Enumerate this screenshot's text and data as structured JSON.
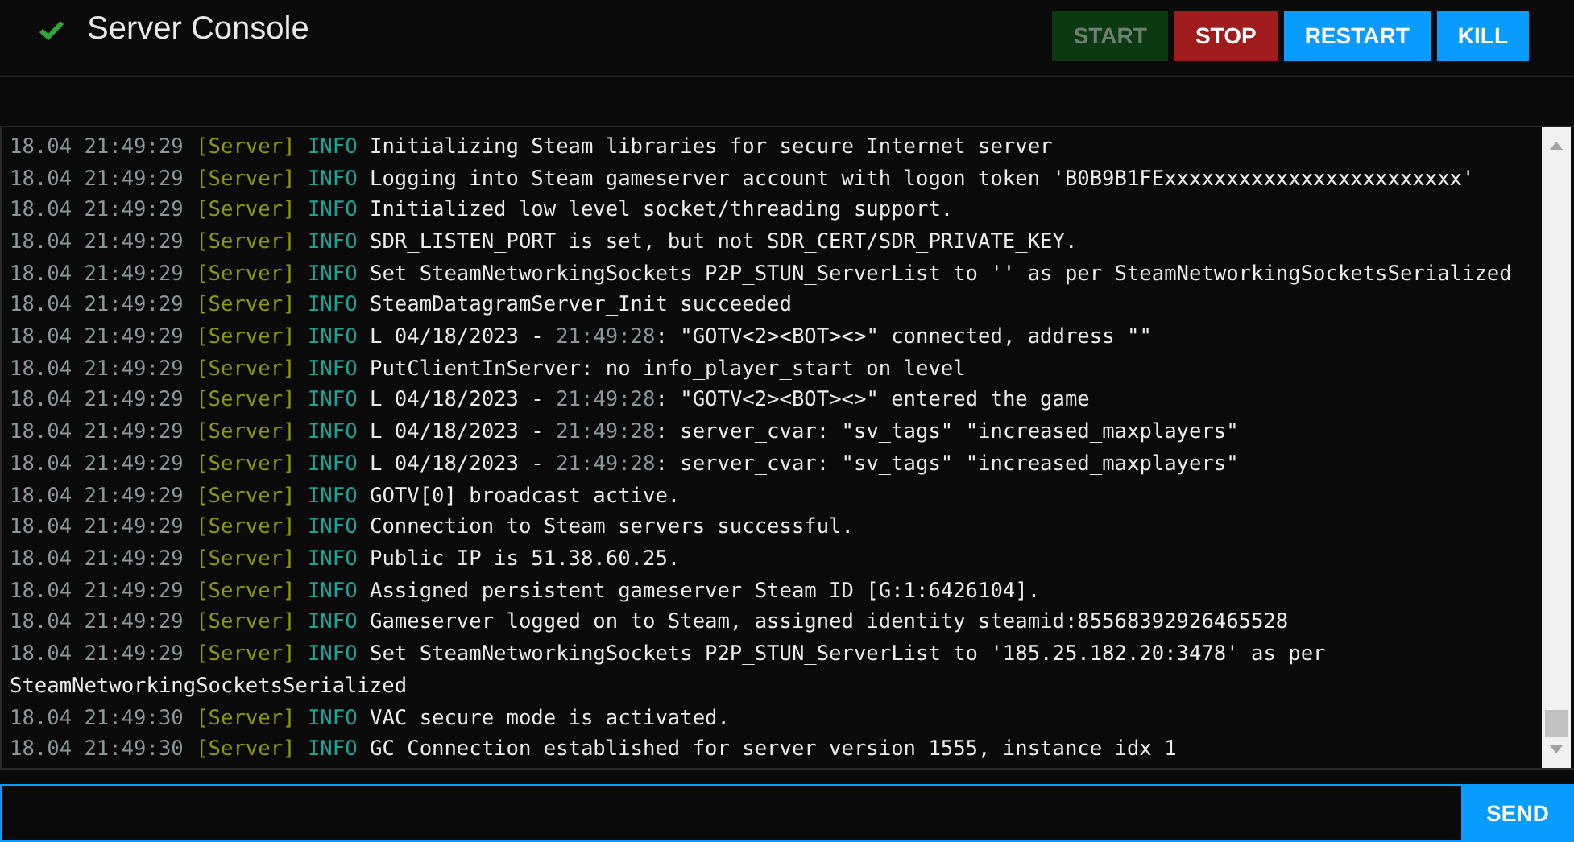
{
  "header": {
    "title": "Server Console",
    "buttons": [
      {
        "label": "START",
        "kind": "start",
        "disabled": true
      },
      {
        "label": "STOP",
        "kind": "stop",
        "disabled": false
      },
      {
        "label": "RESTART",
        "kind": "restart",
        "disabled": false
      },
      {
        "label": "KILL",
        "kind": "kill",
        "disabled": false
      }
    ]
  },
  "log": {
    "lines": [
      {
        "time": "18.04 21:49:29",
        "source": "[Server]",
        "level": "INFO",
        "segments": [
          {
            "text": "Initializing Steam libraries for secure Internet server",
            "kind": "plain"
          }
        ]
      },
      {
        "time": "18.04 21:49:29",
        "source": "[Server]",
        "level": "INFO",
        "segments": [
          {
            "text": "Logging into Steam gameserver account with logon token 'B0B9B1FExxxxxxxxxxxxxxxxxxxxxxxx'",
            "kind": "plain"
          }
        ]
      },
      {
        "time": "18.04 21:49:29",
        "source": "[Server]",
        "level": "INFO",
        "segments": [
          {
            "text": "Initialized low level socket/threading support.",
            "kind": "plain"
          }
        ]
      },
      {
        "time": "18.04 21:49:29",
        "source": "[Server]",
        "level": "INFO",
        "segments": [
          {
            "text": "SDR_LISTEN_PORT is set, but not SDR_CERT/SDR_PRIVATE_KEY.",
            "kind": "plain"
          }
        ]
      },
      {
        "time": "18.04 21:49:29",
        "source": "[Server]",
        "level": "INFO",
        "segments": [
          {
            "text": "Set SteamNetworkingSockets P2P_STUN_ServerList to '' as per SteamNetworkingSocketsSerialized",
            "kind": "plain"
          }
        ]
      },
      {
        "time": "18.04 21:49:29",
        "source": "[Server]",
        "level": "INFO",
        "segments": [
          {
            "text": "SteamDatagramServer_Init succeeded",
            "kind": "plain"
          }
        ]
      },
      {
        "time": "18.04 21:49:29",
        "source": "[Server]",
        "level": "INFO",
        "segments": [
          {
            "text": "L 04/18/2023 - ",
            "kind": "plain"
          },
          {
            "text": "21:49:28",
            "kind": "dim"
          },
          {
            "text": ": \"GOTV<2><BOT><>\" connected, address \"\"",
            "kind": "plain"
          }
        ]
      },
      {
        "time": "18.04 21:49:29",
        "source": "[Server]",
        "level": "INFO",
        "segments": [
          {
            "text": "PutClientInServer: no info_player_start on level",
            "kind": "plain"
          }
        ]
      },
      {
        "time": "18.04 21:49:29",
        "source": "[Server]",
        "level": "INFO",
        "segments": [
          {
            "text": "L 04/18/2023 - ",
            "kind": "plain"
          },
          {
            "text": "21:49:28",
            "kind": "dim"
          },
          {
            "text": ": \"GOTV<2><BOT><>\" entered the game",
            "kind": "plain"
          }
        ]
      },
      {
        "time": "18.04 21:49:29",
        "source": "[Server]",
        "level": "INFO",
        "segments": [
          {
            "text": "L 04/18/2023 - ",
            "kind": "plain"
          },
          {
            "text": "21:49:28",
            "kind": "dim"
          },
          {
            "text": ": server_cvar: \"sv_tags\" \"increased_maxplayers\"",
            "kind": "plain"
          }
        ]
      },
      {
        "time": "18.04 21:49:29",
        "source": "[Server]",
        "level": "INFO",
        "segments": [
          {
            "text": "L 04/18/2023 - ",
            "kind": "plain"
          },
          {
            "text": "21:49:28",
            "kind": "dim"
          },
          {
            "text": ": server_cvar: \"sv_tags\" \"increased_maxplayers\"",
            "kind": "plain"
          }
        ]
      },
      {
        "time": "18.04 21:49:29",
        "source": "[Server]",
        "level": "INFO",
        "segments": [
          {
            "text": "GOTV[0] broadcast active.",
            "kind": "plain"
          }
        ]
      },
      {
        "time": "18.04 21:49:29",
        "source": "[Server]",
        "level": "INFO",
        "segments": [
          {
            "text": "Connection to Steam servers successful.",
            "kind": "plain"
          }
        ]
      },
      {
        "time": "18.04 21:49:29",
        "source": "[Server]",
        "level": "INFO",
        "segments": [
          {
            "text": "Public IP is 51.38.60.25.",
            "kind": "plain"
          }
        ]
      },
      {
        "time": "18.04 21:49:29",
        "source": "[Server]",
        "level": "INFO",
        "segments": [
          {
            "text": "Assigned persistent gameserver Steam ID [G:1:6426104].",
            "kind": "plain"
          }
        ]
      },
      {
        "time": "18.04 21:49:29",
        "source": "[Server]",
        "level": "INFO",
        "segments": [
          {
            "text": "Gameserver logged on to Steam, assigned identity steamid:85568392926465528",
            "kind": "plain"
          }
        ]
      },
      {
        "time": "18.04 21:49:29",
        "source": "[Server]",
        "level": "INFO",
        "segments": [
          {
            "text": "Set SteamNetworkingSockets P2P_STUN_ServerList to '185.25.182.20:3478' as per SteamNetworkingSocketsSerialized",
            "kind": "plain"
          }
        ]
      },
      {
        "time": "18.04 21:49:30",
        "source": "[Server]",
        "level": "INFO",
        "segments": [
          {
            "text": "VAC secure mode is activated.",
            "kind": "plain"
          }
        ]
      },
      {
        "time": "18.04 21:49:30",
        "source": "[Server]",
        "level": "INFO",
        "segments": [
          {
            "text": "GC Connection established for server version 1555, instance idx 1",
            "kind": "plain"
          }
        ]
      }
    ]
  },
  "command": {
    "button": "SEND"
  }
}
